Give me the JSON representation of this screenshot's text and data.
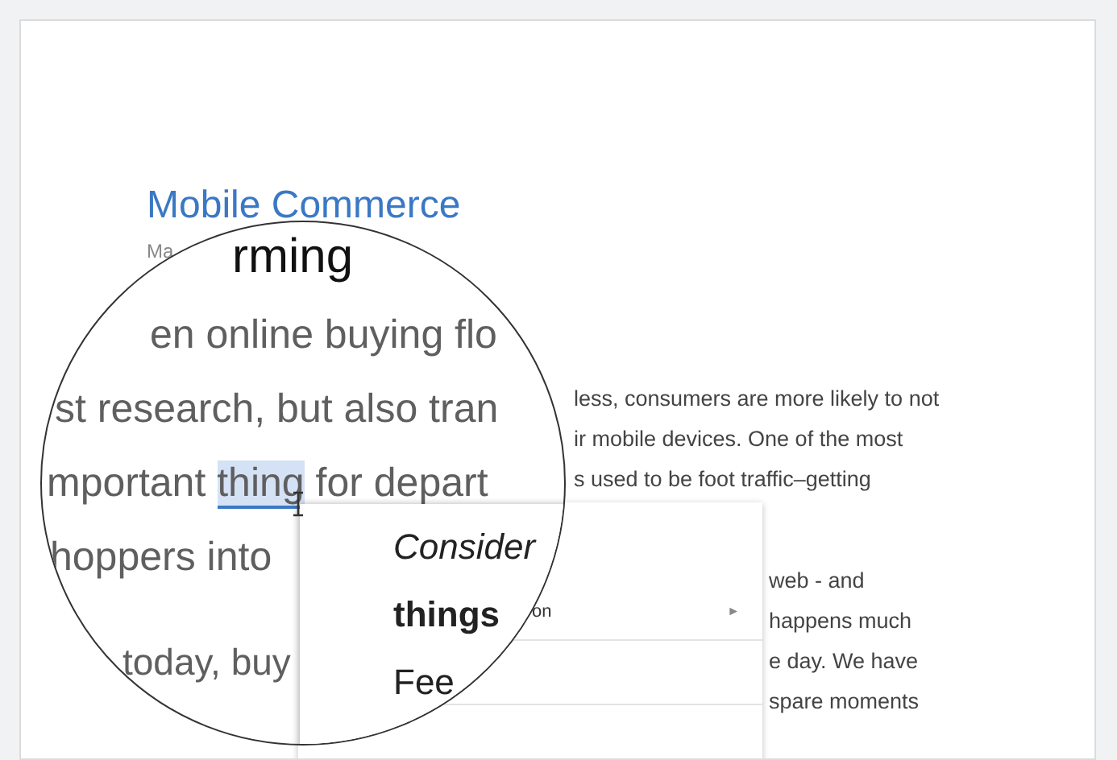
{
  "document": {
    "title": "Mobile Commerce",
    "subtitle": "Ma",
    "body_lines_top": [
      "less, consumers are more likely to not",
      "ir mobile devices. One of the most",
      "s used to be foot traffic–getting"
    ],
    "body_lines_bottom": [
      "web - and",
      "happens much",
      "e day. We have",
      "spare moments"
    ]
  },
  "context_menu": {
    "item_text": "on",
    "arrow": "►"
  },
  "magnifier": {
    "heading_fragment": "rming",
    "lines": [
      [
        {
          "text": "en online buying flo",
          "selected": false
        }
      ],
      [
        {
          "text": "st research, but also tran",
          "selected": false
        }
      ],
      [
        {
          "text": "mportant ",
          "selected": false
        },
        {
          "text": "thing",
          "selected": true
        },
        {
          "text": " for depart",
          "selected": false
        }
      ],
      [
        {
          "text": "hoppers into",
          "selected": false
        }
      ],
      [
        {
          "text": "today, buy",
          "selected": false
        }
      ]
    ],
    "menu_items": [
      {
        "text": "Consider",
        "kind": "heading"
      },
      {
        "text": "things",
        "kind": "suggestion"
      },
      {
        "text": "Fee",
        "kind": "action"
      }
    ]
  }
}
